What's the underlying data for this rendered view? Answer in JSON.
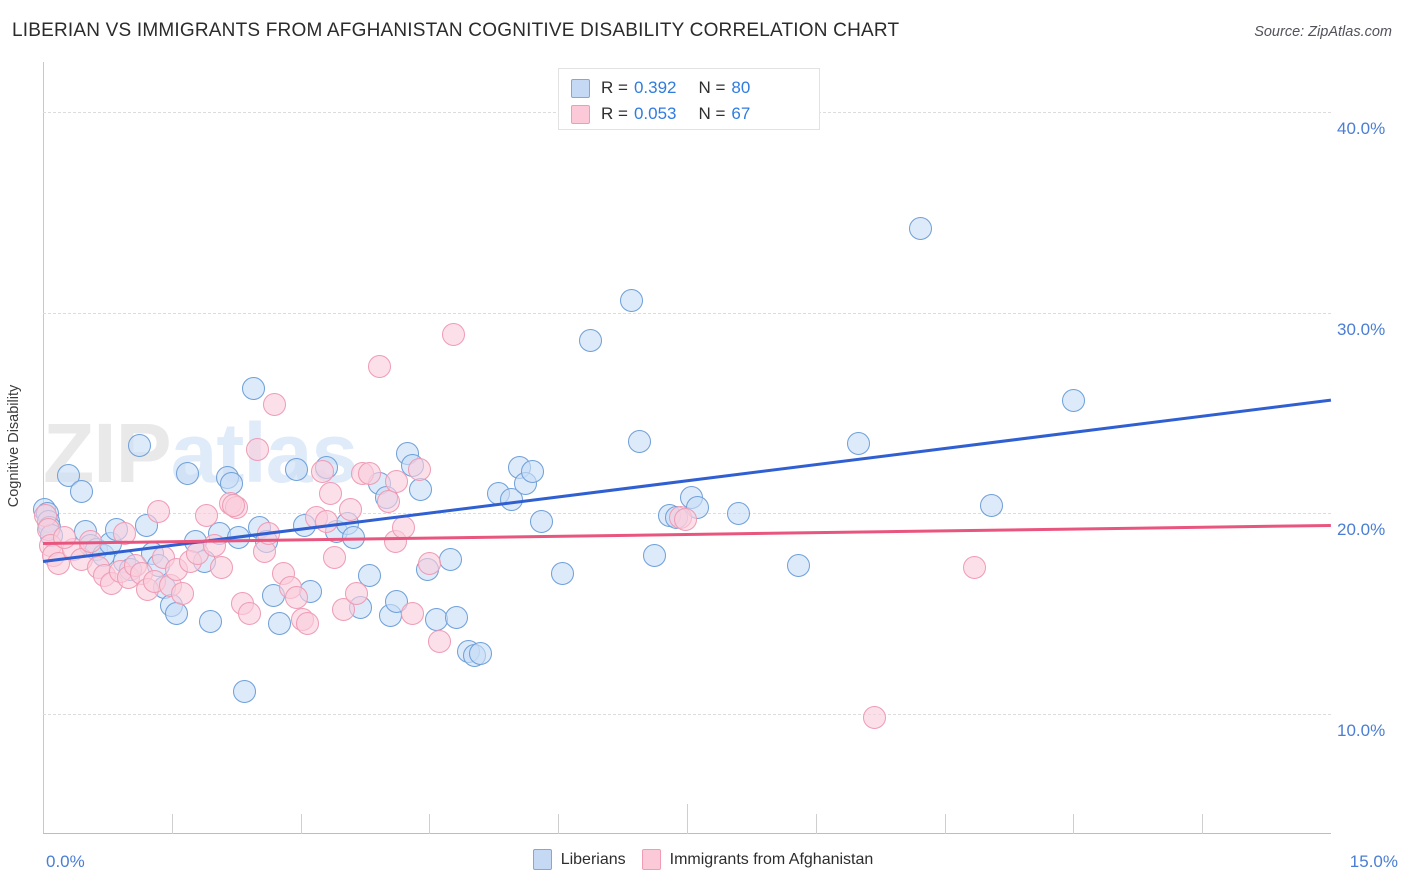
{
  "header": {
    "title": "LIBERIAN VS IMMIGRANTS FROM AFGHANISTAN COGNITIVE DISABILITY CORRELATION CHART",
    "source": "Source: ZipAtlas.com"
  },
  "watermark": {
    "part1": "ZIP",
    "part2": "atlas"
  },
  "stats": {
    "rows": [
      {
        "r_label": "R =",
        "r_value": "0.392",
        "n_label": "N =",
        "n_value": "80",
        "color": "#c5d9f5"
      },
      {
        "r_label": "R =",
        "r_value": "0.053",
        "n_label": "N =",
        "n_value": "67",
        "color": "#fbc9d8"
      }
    ]
  },
  "legend": {
    "items": [
      {
        "label": "Liberians",
        "color": "#c5d9f5",
        "border": "#7fa8dd"
      },
      {
        "label": "Immigrants from Afghanistan",
        "color": "#fbc9d8",
        "border": "#f09cb4"
      }
    ]
  },
  "axis": {
    "y_title": "Cognitive Disability",
    "y_ticks": [
      "40.0%",
      "30.0%",
      "20.0%",
      "10.0%"
    ],
    "x_min_label": "0.0%",
    "x_max_label": "15.0%"
  },
  "chart_data": {
    "type": "scatter",
    "title": "LIBERIAN VS IMMIGRANTS FROM AFGHANISTAN COGNITIVE DISABILITY CORRELATION CHART",
    "xlabel": "",
    "ylabel": "Cognitive Disability",
    "xlim": [
      0.0,
      15.0
    ],
    "ylim": [
      4.0,
      42.5
    ],
    "x_tick_values": [
      0.0,
      15.0
    ],
    "y_tick_values": [
      10.0,
      20.0,
      30.0,
      40.0
    ],
    "grid": "horizontal-dashed",
    "legend_position": "bottom-center",
    "series": [
      {
        "name": "Liberians",
        "color": "#c5d9f5",
        "border_color": "#6e9fd9",
        "R": 0.392,
        "N": 80,
        "trendline": {
          "x0": 0.0,
          "y0": 17.65,
          "x1": 15.0,
          "y1": 25.7,
          "color": "#2f5fd0"
        },
        "points": [
          [
            0.02,
            20.2
          ],
          [
            0.05,
            20.0
          ],
          [
            0.06,
            19.6
          ],
          [
            0.08,
            19.3
          ],
          [
            0.1,
            18.9
          ],
          [
            0.3,
            21.9
          ],
          [
            0.45,
            21.1
          ],
          [
            0.5,
            19.1
          ],
          [
            0.55,
            18.4
          ],
          [
            0.62,
            18.2
          ],
          [
            0.7,
            17.9
          ],
          [
            0.78,
            18.5
          ],
          [
            0.85,
            19.2
          ],
          [
            0.95,
            17.6
          ],
          [
            1.02,
            17.2
          ],
          [
            1.12,
            23.4
          ],
          [
            1.2,
            19.4
          ],
          [
            1.28,
            18.0
          ],
          [
            1.35,
            17.4
          ],
          [
            1.42,
            16.3
          ],
          [
            1.5,
            15.4
          ],
          [
            1.55,
            15.0
          ],
          [
            1.68,
            22.0
          ],
          [
            1.78,
            18.6
          ],
          [
            1.88,
            17.6
          ],
          [
            1.95,
            14.6
          ],
          [
            2.05,
            19.0
          ],
          [
            2.15,
            21.8
          ],
          [
            2.2,
            21.5
          ],
          [
            2.28,
            18.8
          ],
          [
            2.35,
            11.1
          ],
          [
            2.45,
            26.2
          ],
          [
            2.52,
            19.3
          ],
          [
            2.6,
            18.6
          ],
          [
            2.68,
            15.9
          ],
          [
            2.75,
            14.5
          ],
          [
            2.95,
            22.2
          ],
          [
            3.05,
            19.4
          ],
          [
            3.12,
            16.1
          ],
          [
            3.3,
            22.3
          ],
          [
            3.42,
            19.1
          ],
          [
            3.55,
            19.5
          ],
          [
            3.62,
            18.8
          ],
          [
            3.7,
            15.3
          ],
          [
            3.8,
            16.9
          ],
          [
            3.92,
            21.5
          ],
          [
            4.0,
            20.8
          ],
          [
            4.05,
            14.9
          ],
          [
            4.12,
            15.6
          ],
          [
            4.25,
            23.0
          ],
          [
            4.3,
            22.4
          ],
          [
            4.4,
            21.2
          ],
          [
            4.48,
            17.2
          ],
          [
            4.58,
            14.7
          ],
          [
            4.75,
            17.7
          ],
          [
            4.82,
            14.8
          ],
          [
            4.95,
            13.1
          ],
          [
            5.02,
            12.9
          ],
          [
            5.3,
            21.0
          ],
          [
            5.45,
            20.7
          ],
          [
            5.55,
            22.3
          ],
          [
            5.62,
            21.5
          ],
          [
            5.7,
            22.1
          ],
          [
            5.8,
            19.6
          ],
          [
            6.05,
            17.0
          ],
          [
            6.38,
            28.6
          ],
          [
            6.85,
            30.6
          ],
          [
            6.95,
            23.6
          ],
          [
            7.12,
            17.9
          ],
          [
            7.3,
            19.9
          ],
          [
            7.38,
            19.8
          ],
          [
            7.55,
            20.8
          ],
          [
            7.62,
            20.3
          ],
          [
            8.1,
            20.0
          ],
          [
            8.8,
            17.4
          ],
          [
            9.5,
            23.5
          ],
          [
            10.22,
            34.2
          ],
          [
            11.05,
            20.4
          ],
          [
            12.0,
            25.6
          ],
          [
            5.1,
            13.0
          ]
        ]
      },
      {
        "name": "Immigrants from Afghanistan",
        "color": "#fbc9d8",
        "border_color": "#ef9bb4",
        "R": 0.053,
        "N": 67,
        "trendline": {
          "x0": 0.0,
          "y0": 18.55,
          "x1": 15.0,
          "y1": 19.45,
          "color": "#e8567f"
        },
        "points": [
          [
            0.03,
            19.9
          ],
          [
            0.06,
            19.2
          ],
          [
            0.09,
            18.4
          ],
          [
            0.12,
            17.9
          ],
          [
            0.18,
            17.5
          ],
          [
            0.35,
            18.2
          ],
          [
            0.45,
            17.7
          ],
          [
            0.55,
            18.6
          ],
          [
            0.65,
            17.3
          ],
          [
            0.72,
            16.9
          ],
          [
            0.8,
            16.5
          ],
          [
            0.9,
            17.1
          ],
          [
            1.0,
            16.8
          ],
          [
            1.08,
            17.4
          ],
          [
            1.15,
            17.0
          ],
          [
            1.22,
            16.2
          ],
          [
            1.3,
            16.6
          ],
          [
            1.4,
            17.8
          ],
          [
            1.48,
            16.4
          ],
          [
            1.55,
            17.2
          ],
          [
            1.62,
            16.0
          ],
          [
            1.72,
            17.6
          ],
          [
            1.8,
            18.0
          ],
          [
            1.9,
            19.9
          ],
          [
            2.0,
            18.4
          ],
          [
            2.08,
            17.3
          ],
          [
            2.18,
            20.5
          ],
          [
            2.25,
            20.3
          ],
          [
            2.32,
            15.5
          ],
          [
            2.4,
            15.0
          ],
          [
            2.5,
            23.2
          ],
          [
            2.58,
            18.1
          ],
          [
            2.7,
            25.4
          ],
          [
            2.8,
            17.0
          ],
          [
            2.88,
            16.3
          ],
          [
            2.95,
            15.8
          ],
          [
            3.02,
            14.7
          ],
          [
            3.08,
            14.5
          ],
          [
            3.18,
            19.8
          ],
          [
            3.25,
            22.1
          ],
          [
            3.35,
            21.0
          ],
          [
            3.4,
            17.8
          ],
          [
            3.5,
            15.2
          ],
          [
            3.58,
            20.2
          ],
          [
            3.65,
            16.0
          ],
          [
            3.72,
            22.0
          ],
          [
            3.8,
            22.0
          ],
          [
            3.92,
            27.3
          ],
          [
            4.02,
            20.6
          ],
          [
            4.1,
            18.6
          ],
          [
            4.12,
            21.6
          ],
          [
            4.2,
            19.3
          ],
          [
            4.3,
            15.0
          ],
          [
            4.38,
            22.2
          ],
          [
            4.5,
            17.5
          ],
          [
            4.62,
            13.6
          ],
          [
            4.78,
            28.9
          ],
          [
            2.22,
            20.4
          ],
          [
            1.35,
            20.1
          ],
          [
            0.95,
            19.0
          ],
          [
            2.62,
            19.0
          ],
          [
            3.3,
            19.6
          ],
          [
            7.42,
            19.8
          ],
          [
            7.48,
            19.7
          ],
          [
            10.85,
            17.3
          ],
          [
            9.68,
            9.8
          ],
          [
            0.25,
            18.8
          ]
        ]
      }
    ]
  }
}
